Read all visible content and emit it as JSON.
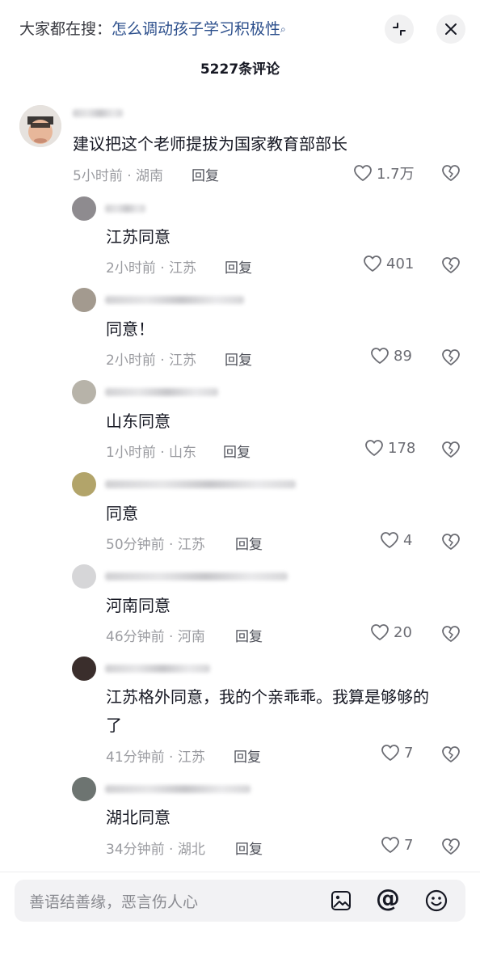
{
  "header": {
    "search_prefix": "大家都在搜：",
    "search_query": "怎么调动孩子学习积极性",
    "search_icon": "magnifier-icon",
    "collapse_icon": "collapse-icon",
    "close_icon": "close-icon"
  },
  "comment_count": "5227条评论",
  "comments": [
    {
      "text": "建议把这个老师提拔为国家教育部部长",
      "time_location": "5小时前 · 湖南",
      "reply": "回复",
      "likes": "1.7万"
    },
    {
      "text": "江苏同意",
      "time_location": "2小时前 · 江苏",
      "reply": "回复",
      "likes": "401"
    },
    {
      "text": "同意！",
      "time_location": "2小时前 · 江苏",
      "reply": "回复",
      "likes": "89"
    },
    {
      "text": "山东同意",
      "time_location": "1小时前 · 山东",
      "reply": "回复",
      "likes": "178"
    },
    {
      "text": "同意",
      "time_location": "50分钟前 · 江苏",
      "reply": "回复",
      "likes": "4"
    },
    {
      "text": "河南同意",
      "time_location": "46分钟前 · 河南",
      "reply": "回复",
      "likes": "20"
    },
    {
      "text_line1": "江苏格外同意，我的个亲乖乖。我算是够够的",
      "text_line2": "了",
      "time_location": "41分钟前 · 江苏",
      "reply": "回复",
      "likes": "7"
    },
    {
      "text": "湖北同意",
      "time_location": "34分钟前 · 湖北",
      "reply": "回复",
      "likes": "7"
    }
  ],
  "input": {
    "placeholder": "善语结善缘，恶言伤人心",
    "image_icon": "image-icon",
    "mention_icon": "at-icon",
    "emoji_icon": "emoji-icon"
  },
  "colors": {
    "link_blue": "#2c4f8c",
    "meta_gray": "#9a9ba0",
    "text_dark": "#161823"
  }
}
